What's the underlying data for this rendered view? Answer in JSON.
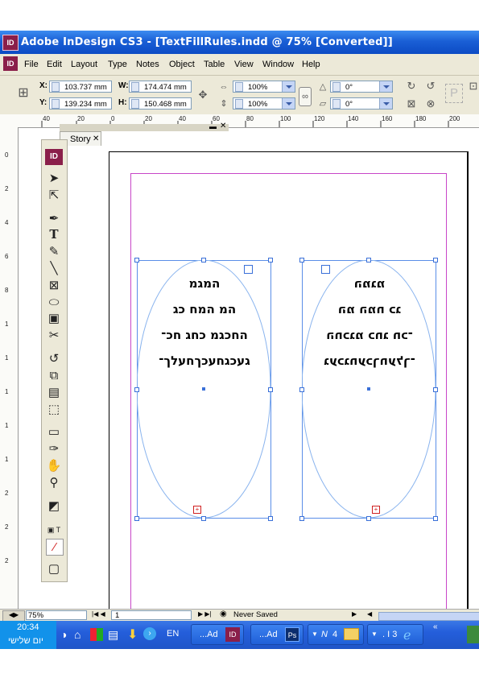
{
  "window": {
    "title": "Adobe InDesign CS3 - [TextFillRules.indd @ 75% [Converted]]",
    "app_icon": "ID"
  },
  "menubar": {
    "items": [
      "File",
      "Edit",
      "Layout",
      "Type",
      "Notes",
      "Object",
      "Table",
      "View",
      "Window",
      "Help"
    ]
  },
  "control": {
    "x_label": "X:",
    "x_value": "103.737 mm",
    "y_label": "Y:",
    "y_value": "139.234 mm",
    "w_label": "W:",
    "w_value": "174.474 mm",
    "h_label": "H:",
    "h_value": "150.468 mm",
    "scale_x": "100%",
    "scale_y": "100%",
    "rotate": "0°",
    "shear": "0°"
  },
  "ruler": {
    "marks": [
      "40",
      "20",
      "0",
      "20",
      "40",
      "60",
      "80",
      "100",
      "120",
      "140",
      "160",
      "180",
      "200"
    ]
  },
  "vruler": {
    "marks": [
      "0",
      "2",
      "4",
      "6",
      "8",
      "1",
      "1",
      "1",
      "1",
      "1",
      "2",
      "2",
      "2"
    ]
  },
  "story_panel": {
    "tab": "Story"
  },
  "toolbox": {
    "logo": "ID"
  },
  "frames": {
    "left_lines": [
      "המגמ",
      "המ המח כג",
      "החכגמ כחג חכ־",
      "געכגחעכךחעלך־"
    ],
    "right_lines": [
      "המגמ",
      "המ המח כג",
      "החכגמ כחג חכ־",
      "געכגחעכךחעלך־"
    ]
  },
  "status": {
    "zoom": "75%",
    "page": "1",
    "save_state": "Never Saved"
  },
  "taskbar": {
    "time": "20:34",
    "day": "יום שלישי",
    "lang": "EN",
    "btn1": "...Ad",
    "btn2": "...Ad",
    "btn3_count": "4",
    "btn4": ". I 3"
  },
  "colors": {
    "titlebar": "#1a5fd6",
    "frame": "#5a8ee8",
    "margin": "#c846c8"
  }
}
